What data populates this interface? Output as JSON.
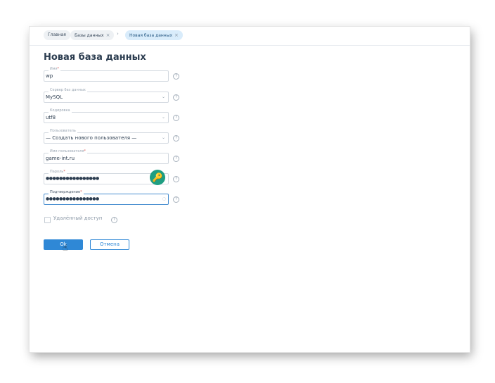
{
  "breadcrumbs": [
    {
      "label": "Главная"
    },
    {
      "label": "Базы данных",
      "close": "×"
    },
    {
      "label": "Новая база данных",
      "close": "×"
    }
  ],
  "breadcrumb_separator": "›",
  "page_title": "Новая база данных",
  "form": {
    "name": {
      "label": "Имя",
      "required": "*",
      "value": "wp"
    },
    "server": {
      "label": "Сервер баз данных",
      "value": "MySQL"
    },
    "encoding": {
      "label": "Кодировка",
      "value": "utf8"
    },
    "user": {
      "label": "Пользователь",
      "value": "— Создать нового пользователя —"
    },
    "username": {
      "label": "Имя пользователя",
      "required": "*",
      "value": "game-int.ru"
    },
    "password": {
      "label": "Пароль",
      "required": "*",
      "value": "●●●●●●●●●●●●●●●●"
    },
    "confirm": {
      "label": "Подтверждение",
      "required": "*",
      "value": "●●●●●●●●●●●●●●●●"
    },
    "remote_access": {
      "label": "Удалённый доступ",
      "checked": false
    }
  },
  "help_glyph": "?",
  "chevron_glyph": "⌄",
  "buttons": {
    "ok": "Ok",
    "cancel": "Отмена"
  },
  "colors": {
    "primary": "#2f88d6",
    "key_badge": "#1f9e82",
    "title": "#2c3d50"
  }
}
